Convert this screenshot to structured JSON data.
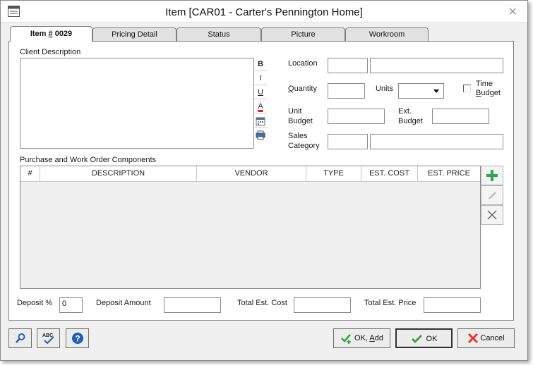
{
  "window": {
    "title": "Item [CAR01 - Carter's Pennington Home]",
    "app_icon": "window-icon",
    "close_glyph": "✕"
  },
  "tabs": [
    {
      "label_prefix": "Item ",
      "label_hotkey": "#",
      "label_rest": " 0029",
      "active": true
    },
    {
      "label": "Pricing Detail"
    },
    {
      "label": "Status"
    },
    {
      "label": "Picture"
    },
    {
      "label": "Workroom"
    }
  ],
  "client_description": {
    "label": "Client Description",
    "value": "",
    "format_buttons": [
      "B",
      "I",
      "U",
      "A"
    ]
  },
  "fields": {
    "location_label": "Location",
    "location_code": "",
    "location_name": "",
    "quantity_hotkey": "Q",
    "quantity_rest": "uantity",
    "quantity_value": "",
    "units_label": "Units",
    "units_value": "",
    "time_budget_label_1": "Time",
    "time_budget_hotkey": "B",
    "time_budget_label_2": "udget",
    "time_budget_checked": false,
    "unit_budget_label_1": "Unit",
    "unit_budget_label_2": "Budget",
    "unit_budget_value": "",
    "ext_budget_label_1": "Ext.",
    "ext_budget_label_2": "Budget",
    "ext_budget_value": "",
    "sales_category_label_1": "Sales",
    "sales_category_label_2": "Category",
    "sales_category_code": "",
    "sales_category_name": ""
  },
  "components": {
    "label": "Purchase and Work Order Components",
    "columns": [
      "#",
      "DESCRIPTION",
      "VENDOR",
      "TYPE",
      "EST. COST",
      "EST. PRICE"
    ],
    "rows": []
  },
  "totals": {
    "deposit_pct_label": "Deposit %",
    "deposit_pct_value": "0",
    "deposit_amount_label": "Deposit Amount",
    "deposit_amount_value": "",
    "total_cost_label": "Total Est. Cost",
    "total_cost_value": "",
    "total_price_label": "Total Est. Price",
    "total_price_value": ""
  },
  "buttons": {
    "ok_add_label": "OK, ",
    "ok_add_hotkey": "A",
    "ok_add_rest": "dd",
    "ok_label": "OK",
    "cancel_label": "Cancel",
    "spell_check_text": "ABC"
  },
  "colors": {
    "add_green": "#2aa84a",
    "ok_green": "#3aa040",
    "cancel_red": "#e0392b",
    "help_blue": "#1f5fb8",
    "underline_red": "#d62020"
  }
}
